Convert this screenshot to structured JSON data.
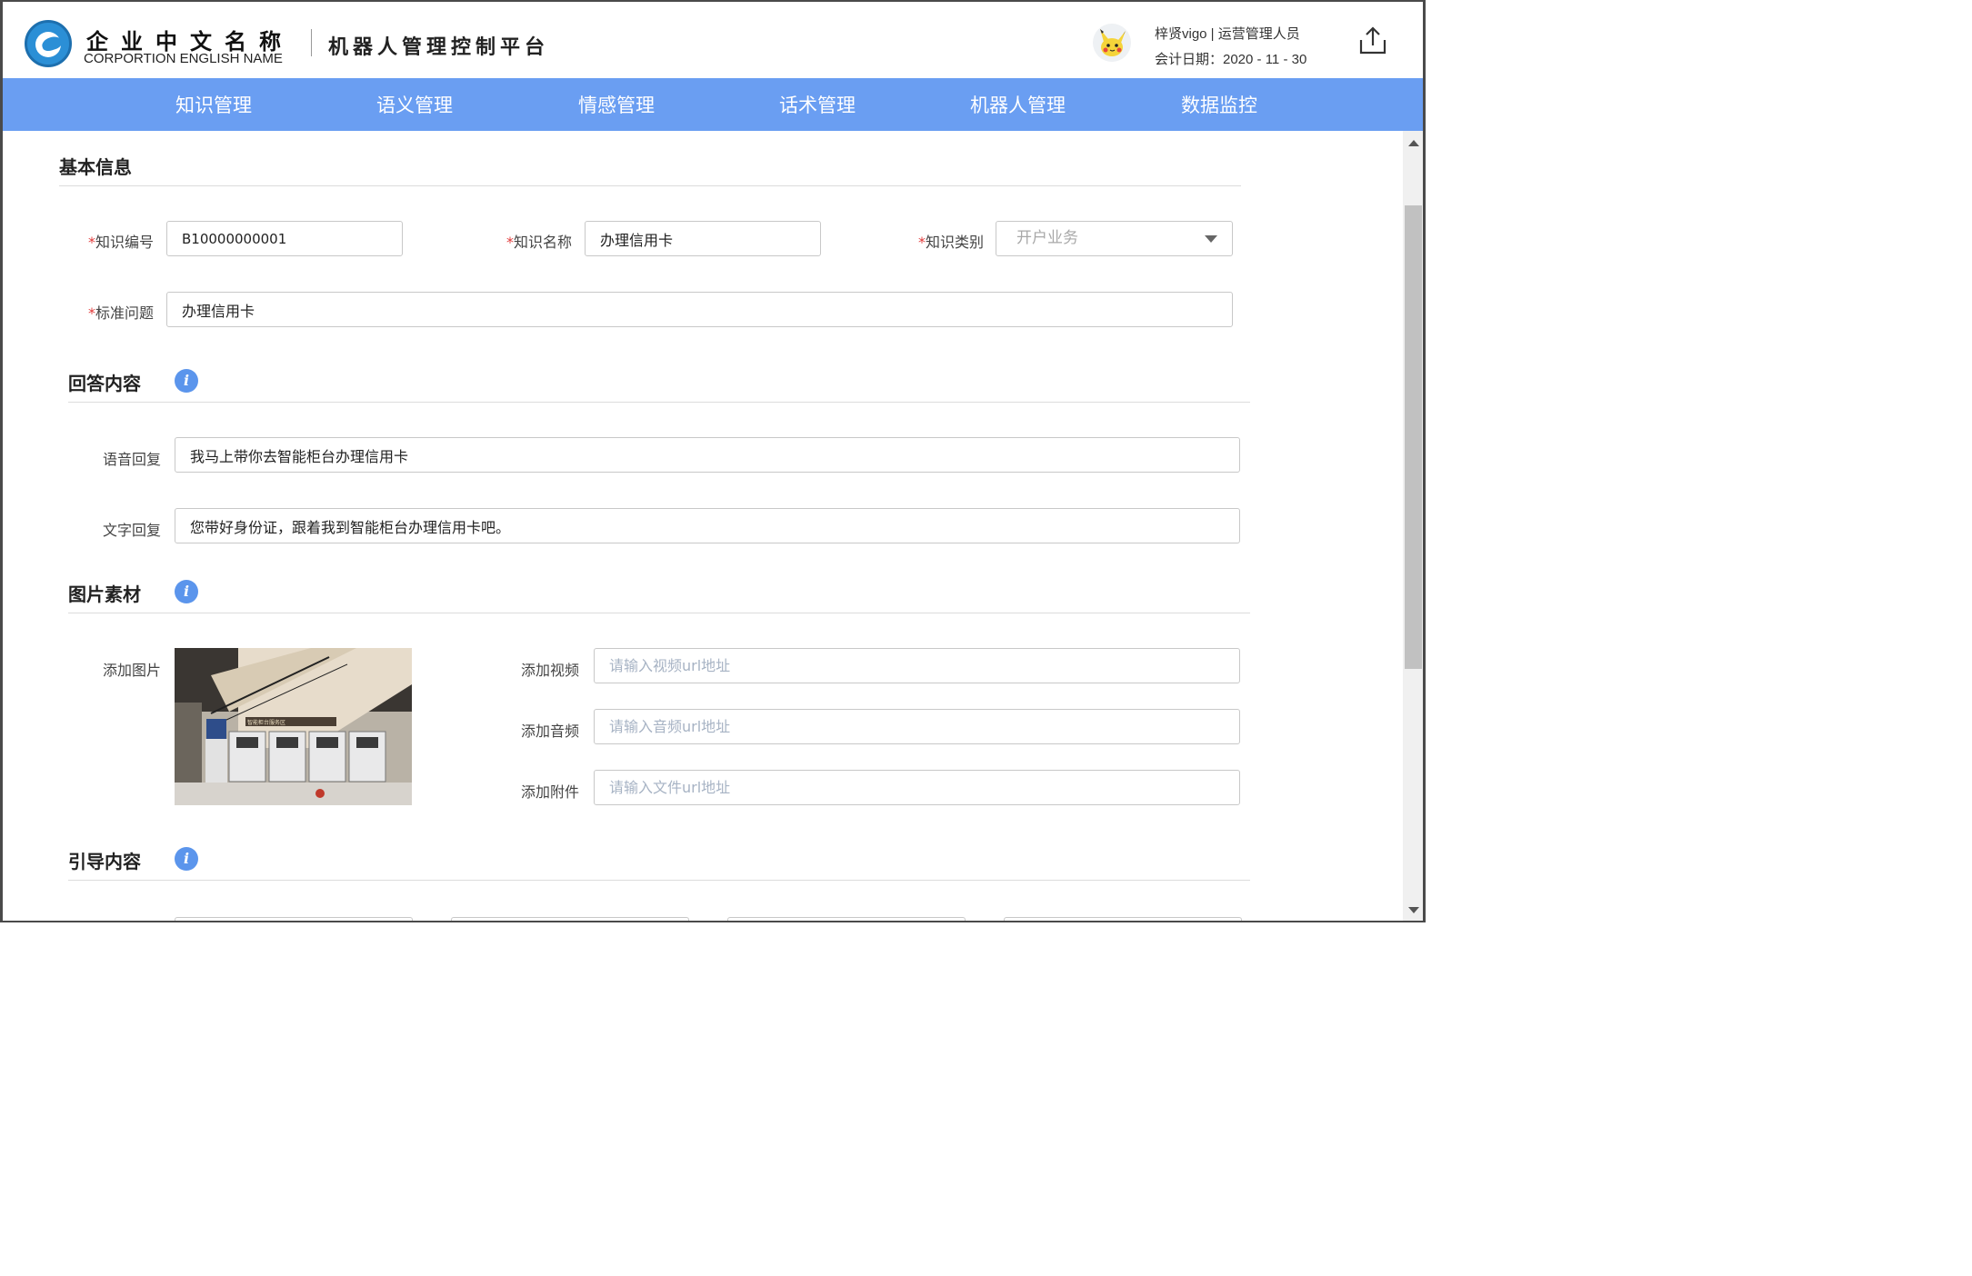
{
  "header": {
    "company_cn": "企业中文名称",
    "company_en": "CORPORTION ENGLISH NAME",
    "platform_title": "机器人管理控制平台",
    "user_line": "梓贤vigo | 运营管理人员",
    "date_line": "会计日期：2020 - 11 - 30",
    "export_icon": "share-upload-icon"
  },
  "nav": {
    "items": [
      "知识管理",
      "语义管理",
      "情感管理",
      "话术管理",
      "机器人管理",
      "数据监控"
    ]
  },
  "basic_info": {
    "title": "基本信息",
    "fields": {
      "knowledge_id": {
        "label": "知识编号",
        "value": "B10000000001"
      },
      "knowledge_name": {
        "label": "知识名称",
        "value": "办理信用卡"
      },
      "knowledge_type": {
        "label": "知识类别",
        "value": "开户业务"
      },
      "standard_question": {
        "label": "标准问题",
        "value": "办理信用卡"
      }
    }
  },
  "answer": {
    "title": "回答内容",
    "voice_reply": {
      "label": "语音回复",
      "value": "我马上带你去智能柜台办理信用卡"
    },
    "text_reply": {
      "label": "文字回复",
      "value": "您带好身份证，跟着我到智能柜台办理信用卡吧。"
    }
  },
  "media": {
    "title": "图片素材",
    "add_image_label": "添加图片",
    "image_sign_text": "智能柜台服务区",
    "add_video": {
      "label": "添加视频",
      "placeholder": "请输入视频url地址"
    },
    "add_audio": {
      "label": "添加音频",
      "placeholder": "请输入音频url地址"
    },
    "add_file": {
      "label": "添加附件",
      "placeholder": "请输入文件url地址"
    }
  },
  "guide": {
    "title": "引导内容"
  },
  "colors": {
    "nav_bg": "#6a9ef2",
    "info_icon": "#5b95ec",
    "required_mark": "#e23b3b"
  }
}
